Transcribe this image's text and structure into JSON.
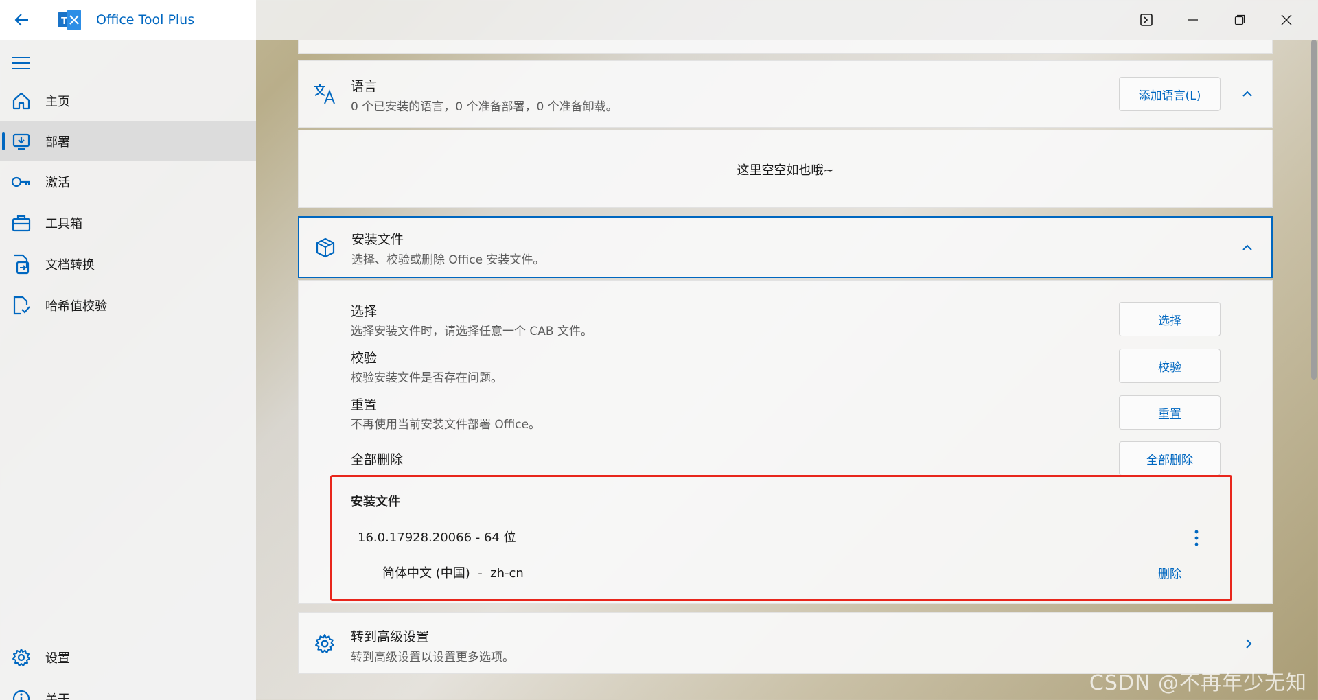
{
  "app": {
    "title": "Office Tool Plus",
    "logo_text": "T"
  },
  "window_controls": [
    "terminal-icon",
    "minimize-icon",
    "restore-icon",
    "close-icon"
  ],
  "sidebar": {
    "items": [
      {
        "label": "主页",
        "icon": "home-icon",
        "active": false
      },
      {
        "label": "部署",
        "icon": "deploy-icon",
        "active": true
      },
      {
        "label": "激活",
        "icon": "key-icon",
        "active": false
      },
      {
        "label": "工具箱",
        "icon": "toolbox-icon",
        "active": false
      },
      {
        "label": "文档转换",
        "icon": "convert-icon",
        "active": false
      },
      {
        "label": "哈希值校验",
        "icon": "hash-check-icon",
        "active": false
      }
    ],
    "bottom_items": [
      {
        "label": "设置",
        "icon": "gear-icon"
      },
      {
        "label": "关于",
        "icon": "info-icon"
      }
    ]
  },
  "language_section": {
    "title": "语言",
    "subtitle": "0 个已安装的语言，0 个准备部署，0 个准备卸载。",
    "add_button": "添加语言(L)",
    "empty_text": "这里空空如也哦~"
  },
  "install_files_section": {
    "title": "安装文件",
    "subtitle": "选择、校验或删除 Office 安装文件。",
    "rows": [
      {
        "title": "选择",
        "subtitle": "选择安装文件时，请选择任意一个 CAB 文件。",
        "button": "选择"
      },
      {
        "title": "校验",
        "subtitle": "校验安装文件是否存在问题。",
        "button": "校验"
      },
      {
        "title": "重置",
        "subtitle": "不再使用当前安装文件部署 Office。",
        "button": "重置"
      },
      {
        "title": "全部删除",
        "subtitle": "",
        "button": "全部删除"
      }
    ],
    "list_header": "安装文件",
    "file_entry": "16.0.17928.20066 - 64 位",
    "language_entry": "简体中文 (中国)  -  zh-cn",
    "delete_link": "删除"
  },
  "advanced_section": {
    "title": "转到高级设置",
    "subtitle": "转到高级设置以设置更多选项。"
  },
  "watermark": "CSDN @不再年少无知",
  "colors": {
    "accent": "#0067c0",
    "highlight_border": "#e8261c"
  }
}
